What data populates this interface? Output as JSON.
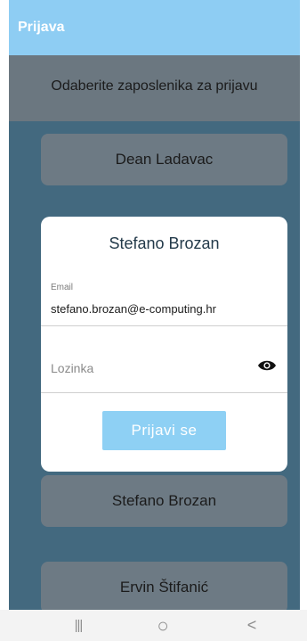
{
  "app": {
    "title": "Prijava"
  },
  "header": {
    "text": "Odaberite zaposlenika za prijavu"
  },
  "employees": [
    {
      "name": "Dean Ladavac"
    },
    {
      "name": "Stefano Brozan"
    },
    {
      "name": "Ervin Štifanić"
    }
  ],
  "dialog": {
    "title": "Stefano Brozan",
    "email_label": "Email",
    "email_value": "stefano.brozan@e-computing.hr",
    "password_placeholder": "Lozinka",
    "password_toggle_icon": "eye-icon",
    "login_label": "Prijavi se"
  },
  "navbar": {
    "recents_glyph": "|||",
    "home_glyph": "○",
    "back_glyph": "<"
  },
  "colors": {
    "appbar": "#8ecdf3",
    "background": "#43697f",
    "button": "#6d7a84",
    "login_button": "#8ed0f4"
  }
}
